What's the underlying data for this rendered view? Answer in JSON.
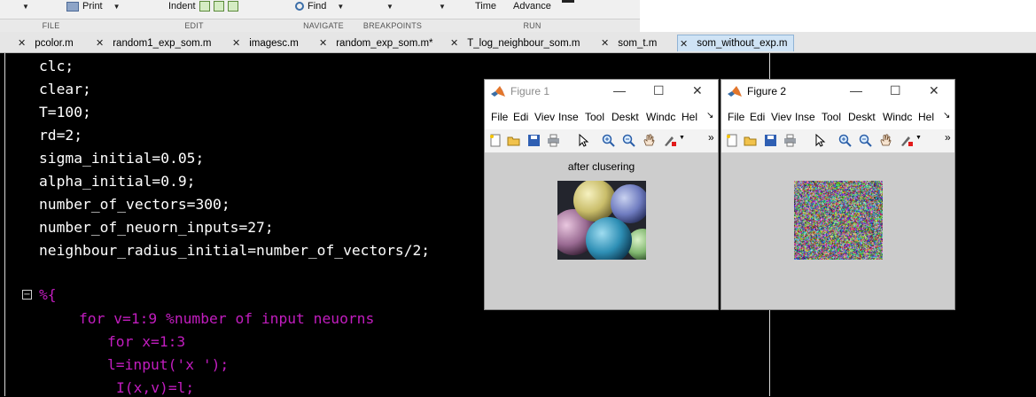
{
  "toolstrip": {
    "print_label": "Print",
    "indent_label": "Indent",
    "find_label": "Find",
    "time_label": "Time",
    "advance_label": "Advance",
    "sections": [
      "FILE",
      "EDIT",
      "NAVIGATE",
      "BREAKPOINTS",
      "RUN"
    ]
  },
  "tabs": [
    {
      "label": "pcolor.m"
    },
    {
      "label": "random1_exp_som.m"
    },
    {
      "label": "imagesc.m"
    },
    {
      "label": "random_exp_som.m*"
    },
    {
      "label": "T_log_neighbour_som.m"
    },
    {
      "label": "som_t.m"
    },
    {
      "label": "som_without_exp.m"
    }
  ],
  "editor": {
    "lines": [
      "clc;",
      "clear;",
      "T=100;",
      "rd=2;",
      "sigma_initial=0.05;",
      "alpha_initial=0.9;",
      "number_of_vectors=300;",
      "number_of_neuorn_inputs=27;",
      "neighbour_radius_initial=number_of_vectors/2;",
      "%{",
      "for v=1:9 %number of input neuorns",
      "for x=1:3",
      "l=input('x ');",
      "I(x,v)=l;"
    ],
    "fold_symbol": "−"
  },
  "figure1": {
    "title": "Figure 1",
    "menus": [
      "File",
      "Edi",
      "Viev",
      "Inse",
      "Tool",
      "Deskt",
      "Windc",
      "Hel",
      "↘"
    ],
    "caption": "after clusering"
  },
  "figure2": {
    "title": "Figure 2",
    "menus": [
      "File",
      "Edi",
      "Viev",
      "Inse",
      "Tool",
      "Deskt",
      "Windc",
      "Hel",
      "↘"
    ]
  },
  "window_buttons": {
    "minimize": "—",
    "maximize": "☐",
    "close": "✕"
  },
  "colors": {
    "editor_bg": "#000000",
    "code_text": "#ffffff",
    "comment_text": "#c21dbf",
    "active_tab": "#cfe3f5"
  }
}
